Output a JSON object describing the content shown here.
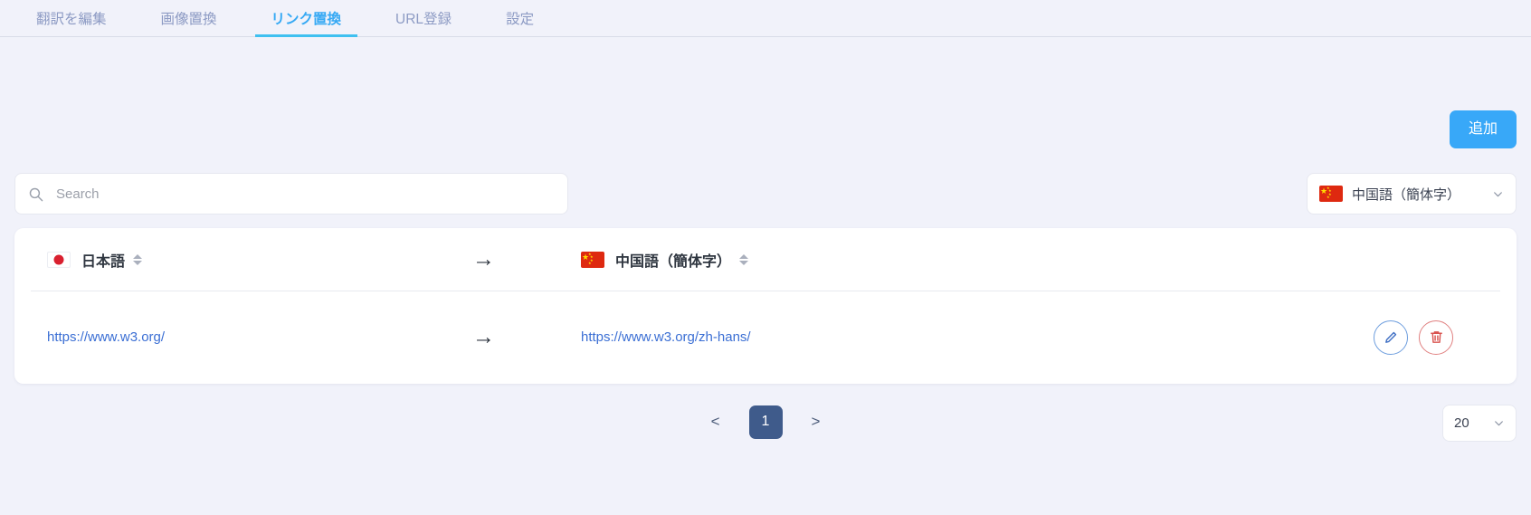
{
  "tabs": [
    {
      "label": "翻訳を編集",
      "active": false
    },
    {
      "label": "画像置換",
      "active": false
    },
    {
      "label": "リンク置換",
      "active": true
    },
    {
      "label": "URL登録",
      "active": false
    },
    {
      "label": "設定",
      "active": false
    }
  ],
  "toolbar": {
    "add_label": "追加"
  },
  "search": {
    "value": "",
    "placeholder": "Search",
    "icon": "search-icon"
  },
  "language_filter": {
    "value": "中国語（簡体字）",
    "flag": "cn-flag-icon",
    "chevron": "chevron-down-icon"
  },
  "table": {
    "columns": [
      {
        "label": "日本語",
        "flag": "jp-flag-icon",
        "sortable": true
      },
      {
        "arrow": "arrow-right-icon"
      },
      {
        "label": "中国語（簡体字）",
        "flag": "cn-flag-icon",
        "sortable": true
      }
    ],
    "rows": [
      {
        "source_url": "https://www.w3.org/",
        "arrow": "arrow-right-icon",
        "target_url": "https://www.w3.org/zh-hans/",
        "actions": [
          {
            "name": "edit-button",
            "icon": "pencil-icon"
          },
          {
            "name": "delete-button",
            "icon": "trash-icon"
          }
        ]
      }
    ]
  },
  "pagination": {
    "prev_label": "<",
    "next_label": ">",
    "pages": [
      "1"
    ],
    "current_page": "1",
    "page_size": "20",
    "page_size_chevron": "chevron-down-icon"
  },
  "colors": {
    "background": "#f1f2fa",
    "active_tab": "#36a9f4",
    "tab_underline": "#3fc0f0",
    "inactive_tab": "#8d9bc4",
    "add_button": "#38a8f8",
    "link": "#3b6fd4",
    "page_active": "#3f5b8b",
    "edit_border": "#6e9ede",
    "delete_border": "#e08080"
  }
}
